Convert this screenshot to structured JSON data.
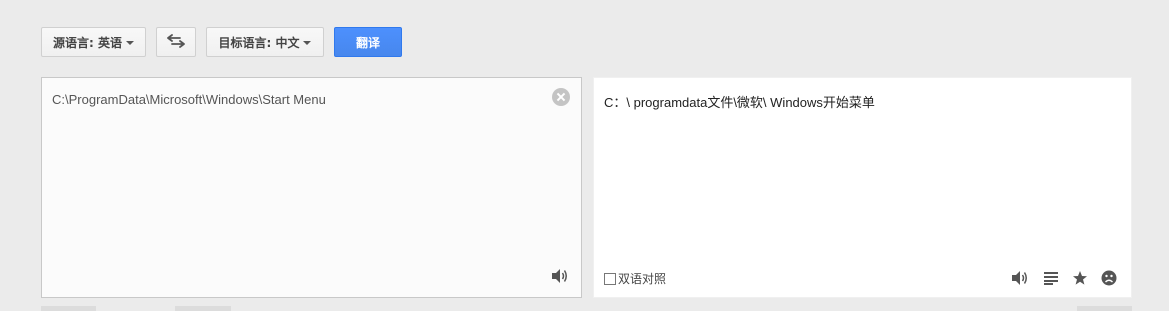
{
  "toolbar": {
    "source_language_label": "源语言: 英语",
    "target_language_label": "目标语言: 中文",
    "translate_label": "翻译",
    "swap_icon": "swap-arrows-icon"
  },
  "source_panel": {
    "text": "C:\\ProgramData\\Microsoft\\Windows\\Start Menu",
    "clear_icon": "clear-icon",
    "speaker_icon": "speaker-icon"
  },
  "target_panel": {
    "text": "C：\\ programdata文件\\微软\\ Windows开始菜单",
    "bilingual_label": "双语对照",
    "bilingual_checked": false,
    "icons": [
      "speaker-icon",
      "list-icon",
      "star-icon",
      "sad-face-icon"
    ]
  },
  "colors": {
    "background": "#ebebeb",
    "accent": "#4d90fe",
    "icon": "#555555"
  }
}
